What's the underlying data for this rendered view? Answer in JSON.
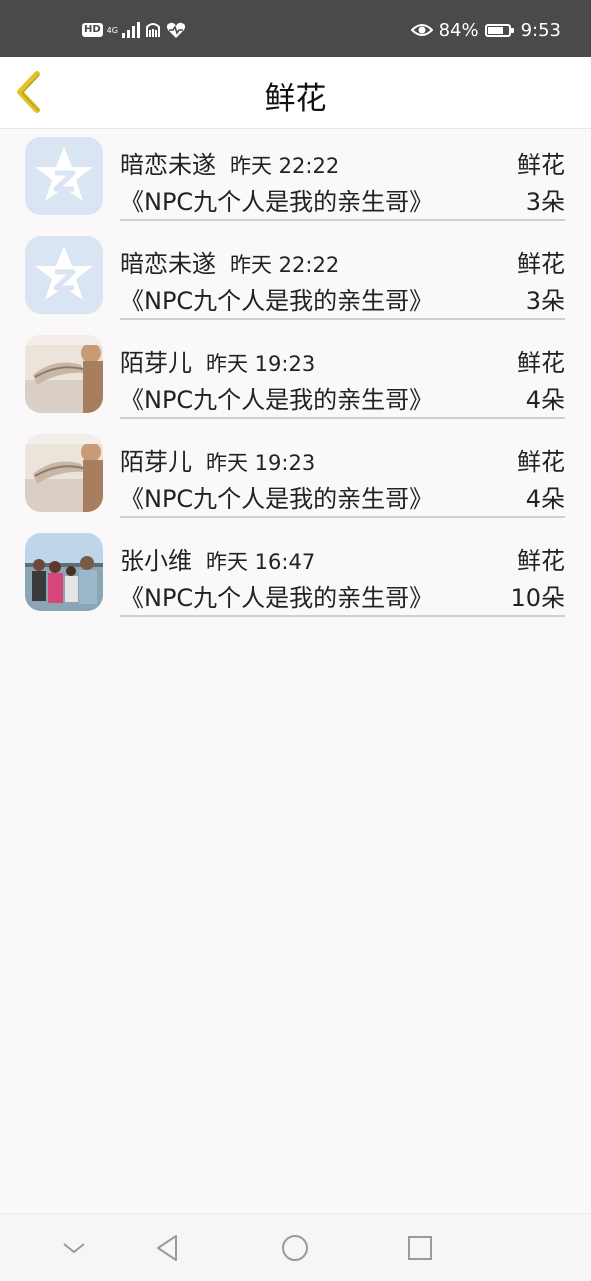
{
  "status_bar": {
    "network": "4G",
    "battery": "84%",
    "battery_level": 0.84,
    "time": "9:53"
  },
  "header": {
    "title": "鲜花"
  },
  "records": [
    {
      "name": "暗恋未遂",
      "time": "昨天 22:22",
      "gift_type": "鲜花",
      "book": "《NPC九个人是我的亲生哥》",
      "count": "3朵",
      "avatar": "qzone-star-avatar"
    },
    {
      "name": "暗恋未遂",
      "time": "昨天 22:22",
      "gift_type": "鲜花",
      "book": "《NPC九个人是我的亲生哥》",
      "count": "3朵",
      "avatar": "qzone-star-avatar"
    },
    {
      "name": "陌芽儿",
      "time": "昨天 19:23",
      "gift_type": "鲜花",
      "book": "《NPC九个人是我的亲生哥》",
      "count": "4朵",
      "avatar": "photo-avatar"
    },
    {
      "name": "陌芽儿",
      "time": "昨天 19:23",
      "gift_type": "鲜花",
      "book": "《NPC九个人是我的亲生哥》",
      "count": "4朵",
      "avatar": "photo-avatar"
    },
    {
      "name": "张小维",
      "time": "昨天 16:47",
      "gift_type": "鲜花",
      "book": "《NPC九个人是我的亲生哥》",
      "count": "10朵",
      "avatar": "group-photo-avatar"
    }
  ],
  "colors": {
    "status_bar": "#4a4a4a",
    "back_arrow": "#e2c22a",
    "background": "#faf8f9"
  }
}
